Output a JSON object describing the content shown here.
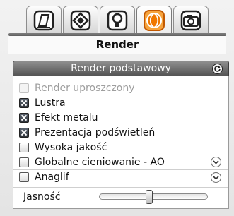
{
  "tabs": [
    {
      "id": "scene",
      "icon": "scene-icon",
      "active": false
    },
    {
      "id": "materials",
      "icon": "material-icon",
      "active": false
    },
    {
      "id": "lights",
      "icon": "light-bulb-icon",
      "active": false
    },
    {
      "id": "render",
      "icon": "render-sphere-icon",
      "active": true
    },
    {
      "id": "camera",
      "icon": "camera-icon",
      "active": false
    }
  ],
  "page": {
    "title": "Render"
  },
  "section": {
    "title": "Render podstawowy",
    "options": [
      {
        "label": "Render uproszczony",
        "checked": false,
        "enabled": false
      },
      {
        "label": "Lustra",
        "checked": true,
        "enabled": true
      },
      {
        "label": "Efekt metalu",
        "checked": true,
        "enabled": true
      },
      {
        "label": "Prezentacja podświetleń",
        "checked": true,
        "enabled": true
      },
      {
        "label": "Wysoka jakość",
        "checked": false,
        "enabled": true
      },
      {
        "label": "Globalne cieniowanie - AO",
        "checked": false,
        "enabled": true,
        "expandable": true
      },
      {
        "label": "Anaglif",
        "checked": false,
        "enabled": true,
        "expandable": true
      }
    ],
    "brightness": {
      "label": "Jasność",
      "value": 0.5
    }
  },
  "colors": {
    "accent": "#f07800",
    "header": "#666666"
  }
}
